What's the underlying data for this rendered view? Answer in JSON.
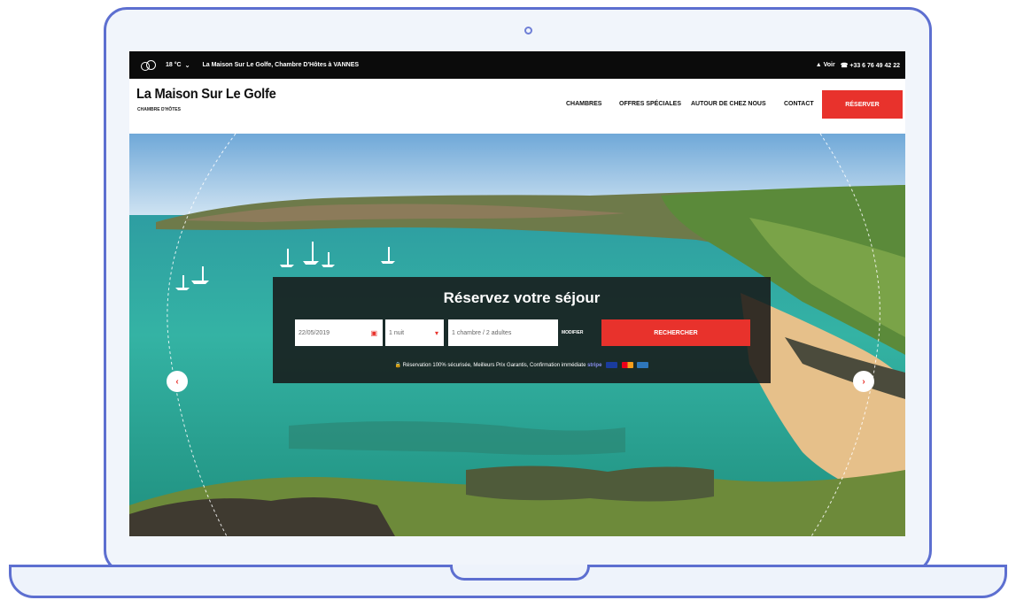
{
  "topbar": {
    "temperature": "18 °C",
    "tagline": "La Maison Sur Le Golfe, Chambre D'Hôtes à VANNES",
    "link": "▲ Voir",
    "phone": "☎ +33 6 76 49 42 22"
  },
  "header": {
    "title": "La Maison Sur Le Golfe",
    "subtitle": "CHAMBRE D'HÔTES",
    "nav": [
      "CHAMBRES",
      "OFFRES SPÉCIALES",
      "AUTOUR DE CHEZ NOUS",
      "CONTACT"
    ],
    "cta": "RÉSERVER"
  },
  "booking": {
    "title": "Réservez votre séjour",
    "date_value": "22/05/2019",
    "nights_value": "1 nuit",
    "guests_value": "1 chambre / 2 adultes",
    "modify_label": "MODIFIER",
    "search_label": "RECHERCHER",
    "secure_text": "🔒 Réservation 100% sécurisée, Meilleurs Prix Garantis, Confirmation immédiate",
    "stripe_label": "stripe",
    "cards": [
      "VISA",
      "Mastercard",
      "Amex"
    ]
  },
  "colors": {
    "accent": "#e8322c",
    "frame": "#5d6fd0"
  },
  "icons": [
    "weather-icon",
    "chevron-down-icon",
    "calendar-icon",
    "dropdown-icon",
    "lock-icon",
    "arrow-left-icon",
    "arrow-right-icon"
  ]
}
